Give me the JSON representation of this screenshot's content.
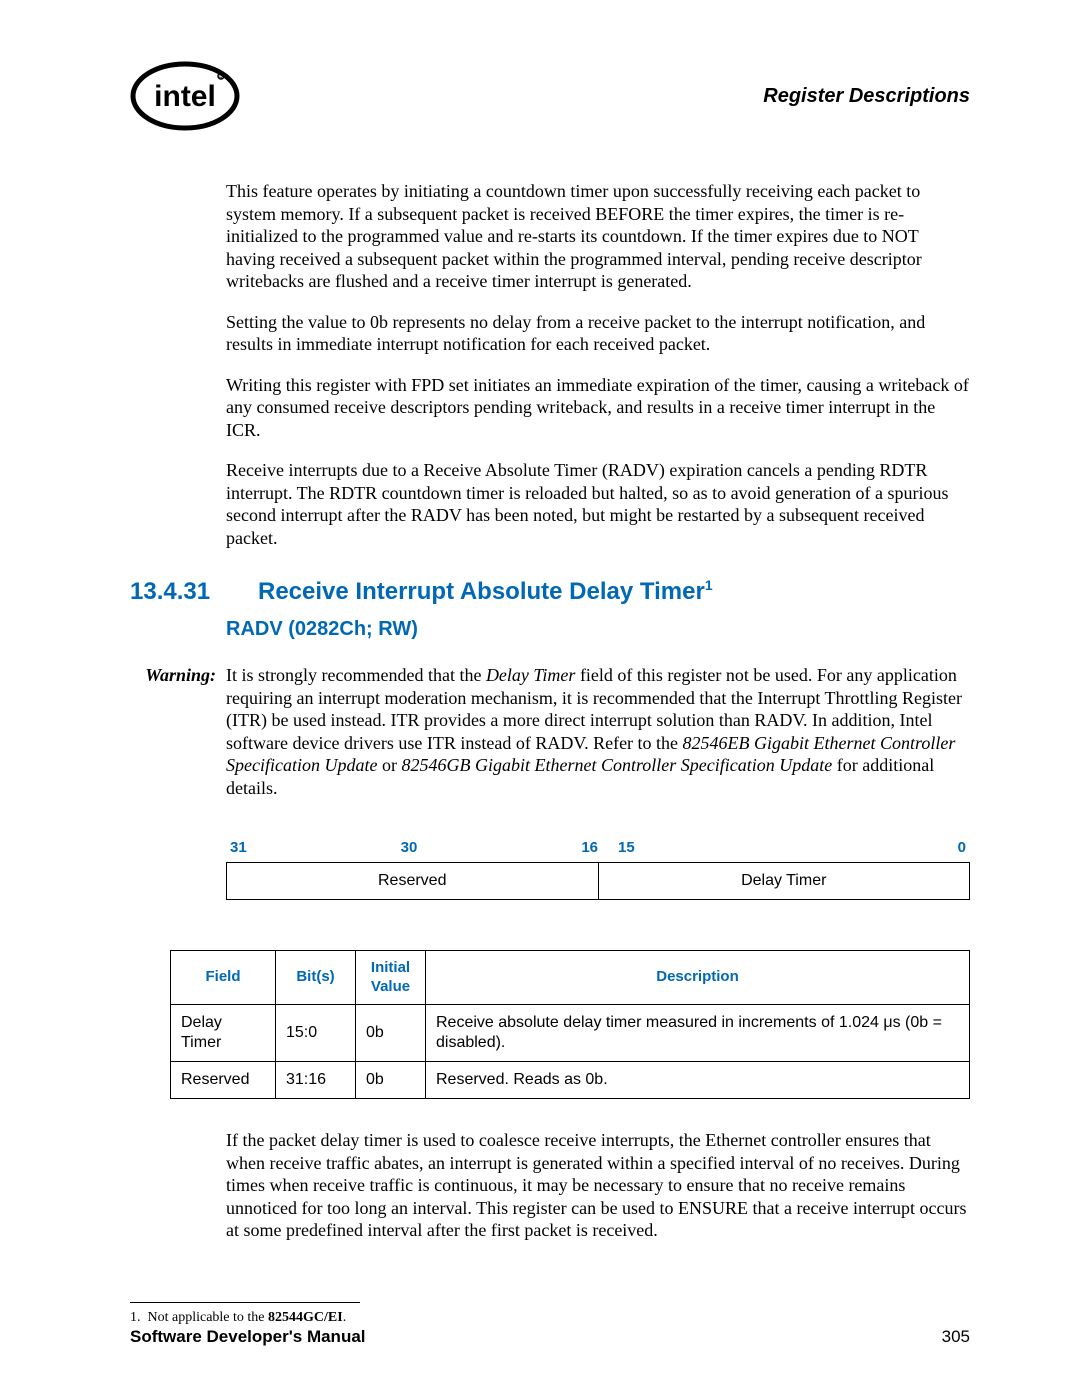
{
  "header": {
    "section_title": "Register Descriptions"
  },
  "intro_paragraphs": [
    "This feature operates by initiating a countdown timer upon successfully receiving each packet to system memory. If a subsequent packet is received BEFORE the timer expires, the timer is re-initialized to the programmed value and re-starts its countdown. If the timer expires due to NOT having received a subsequent packet within the programmed interval, pending receive descriptor writebacks are flushed and a receive timer interrupt is generated.",
    "Setting the value to 0b represents no delay from a receive packet to the interrupt notification, and results in immediate interrupt notification for each received packet.",
    "Writing this register with FPD set initiates an immediate expiration of the timer, causing a writeback of any consumed receive descriptors pending writeback, and results in a receive timer interrupt in the ICR.",
    "Receive interrupts due to a Receive Absolute Timer (RADV) expiration cancels a pending RDTR interrupt. The RDTR countdown timer is reloaded but halted, so as to avoid generation of a spurious second interrupt after the RADV has been noted, but might be restarted by a subsequent received packet."
  ],
  "section": {
    "number": "13.4.31",
    "title": "Receive Interrupt Absolute Delay Timer",
    "superscript": "1",
    "subtitle": "RADV (0282Ch; RW)"
  },
  "warning": {
    "label": "Warning:",
    "pre_italic": "It is strongly recommended that the ",
    "italic1": "Delay Timer",
    "mid": " field of this register not be used. For any application requiring an interrupt moderation mechanism, it is recommended that the Interrupt Throttling Register (ITR) be used instead. ITR provides a more direct interrupt solution than RADV. In addition, Intel software device drivers use ITR instead of RADV. Refer to the ",
    "italic2": "82546EB Gigabit Ethernet Controller Specification Update",
    "mid2": " or ",
    "italic3": "82546GB Gigabit Ethernet Controller Specification Update",
    "post": " for additional details."
  },
  "bit_diagram": {
    "labels": {
      "b31": "31",
      "b30": "30",
      "b16": "16",
      "b15": "15",
      "b0": "0"
    },
    "fields": {
      "reserved": "Reserved",
      "delay": "Delay Timer"
    }
  },
  "field_table": {
    "headers": {
      "field": "Field",
      "bits": "Bit(s)",
      "initial": "Initial Value",
      "desc": "Description"
    },
    "rows": [
      {
        "field": "Delay Timer",
        "bits": "15:0",
        "initial": "0b",
        "desc": "Receive absolute delay timer measured in increments of 1.024 μs (0b = disabled)."
      },
      {
        "field": "Reserved",
        "bits": "31:16",
        "initial": "0b",
        "desc": "Reserved. Reads as 0b."
      }
    ]
  },
  "closing_paragraph": "If the packet delay timer is used to coalesce receive interrupts, the Ethernet controller ensures that when receive traffic abates, an interrupt is generated within a specified interval of no receives. During times when receive traffic is continuous, it may be necessary to ensure that no receive remains unnoticed for too long an interval. This register can be used to ENSURE that a receive interrupt occurs at some predefined interval after the first packet is received.",
  "footnote": {
    "marker": "1.",
    "pre": "Not applicable to the ",
    "bold": "82544GC/EI",
    "post": "."
  },
  "footer": {
    "manual": "Software Developer's Manual",
    "page": "305"
  }
}
